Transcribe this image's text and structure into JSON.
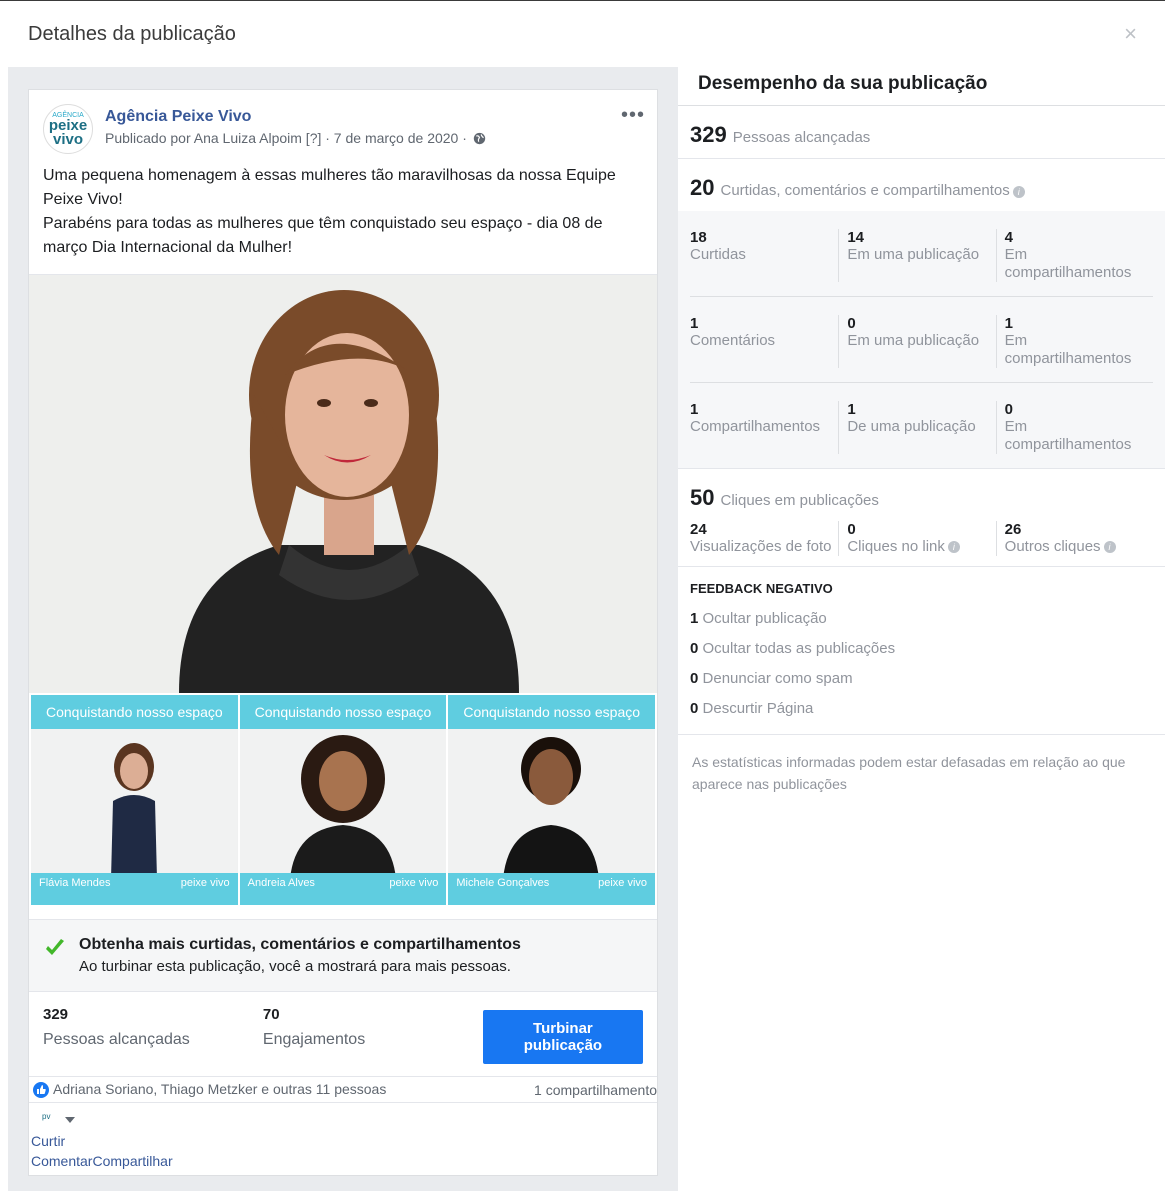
{
  "dialog": {
    "title": "Detalhes da publicação",
    "close_glyph": "×"
  },
  "post": {
    "logo_top": "AGÊNCIA",
    "logo_line1": "peixe",
    "logo_line2": "vivo",
    "page_name": "Agência Peixe Vivo",
    "meta": "Publicado por Ana Luiza Alpoim [?] · 7 de março de 2020 ·",
    "more_glyph": "•••",
    "text_line1": "Uma pequena homenagem à essas mulheres tão maravilhosas da nossa Equipe Peixe Vivo!",
    "text_line2": "Parabéns para todas as mulheres que têm conquistado seu espaço - dia 08 de março Dia Internacional da Mulher!",
    "thumbs": [
      {
        "head": "Conquistando nosso espaço",
        "name": "Flávia Mendes",
        "logo": "peixe vivo"
      },
      {
        "head": "Conquistando nosso espaço",
        "name": "Andreia Alves",
        "logo": "peixe vivo"
      },
      {
        "head": "Conquistando nosso espaço",
        "name": "Michele Gonçalves",
        "logo": "peixe vivo"
      }
    ],
    "boost_title": "Obtenha mais curtidas, comentários e compartilhamentos",
    "boost_sub": "Ao turbinar esta publicação, você a mostrará para mais pessoas.",
    "reach_num": "329",
    "reach_lbl": "Pessoas alcançadas",
    "eng_num": "70",
    "eng_lbl": "Engajamentos",
    "boost_btn": "Turbinar publicação",
    "reactors": "Adriana Soriano, Thiago Metzker e outras 11 pessoas",
    "shares": "1 compartilhamento",
    "action_like": "Curtir",
    "action_comment": "Comentar",
    "action_share": "Compartilhar"
  },
  "performance": {
    "title": "Desempenho da sua publicação",
    "reach_num": "329",
    "reach_lbl": "Pessoas alcançadas",
    "eng_num": "20",
    "eng_lbl": "Curtidas, comentários e compartilhamentos",
    "grid": [
      [
        {
          "n": "18",
          "l": "Curtidas"
        },
        {
          "n": "14",
          "l": "Em uma publicação"
        },
        {
          "n": "4",
          "l": "Em compartilhamentos"
        }
      ],
      [
        {
          "n": "1",
          "l": "Comentários"
        },
        {
          "n": "0",
          "l": "Em uma publicação"
        },
        {
          "n": "1",
          "l": "Em compartilhamentos"
        }
      ],
      [
        {
          "n": "1",
          "l": "Compartilhamentos"
        },
        {
          "n": "1",
          "l": "De uma publicação"
        },
        {
          "n": "0",
          "l": "Em compartilhamentos"
        }
      ]
    ],
    "clicks_num": "50",
    "clicks_lbl": "Cliques em publicações",
    "clicks": [
      {
        "n": "24",
        "l": "Visualizações de foto"
      },
      {
        "n": "0",
        "l": "Cliques no link"
      },
      {
        "n": "26",
        "l": "Outros cliques"
      }
    ],
    "neg_title": "FEEDBACK NEGATIVO",
    "neg": [
      {
        "n": "1",
        "l": "Ocultar publicação"
      },
      {
        "n": "0",
        "l": "Ocultar todas as publicações"
      },
      {
        "n": "0",
        "l": "Denunciar como spam"
      },
      {
        "n": "0",
        "l": "Descurtir Página"
      }
    ],
    "disclaimer": "As estatísticas informadas podem estar defasadas em relação ao que aparece nas publicações",
    "info_glyph": "i"
  }
}
